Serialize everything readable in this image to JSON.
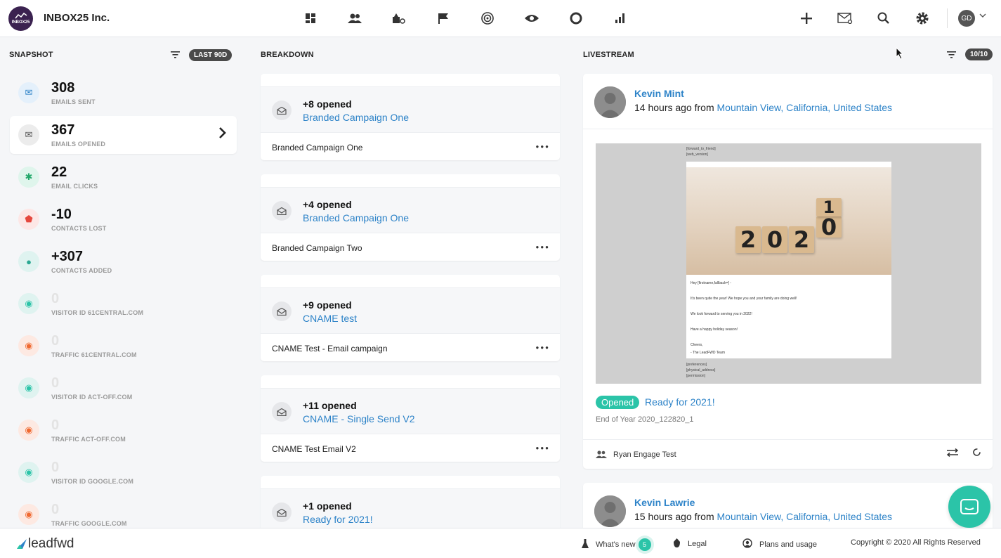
{
  "header": {
    "logo_text": "INBOX25",
    "company": "INBOX25 Inc.",
    "nav_icons": [
      "dashboard-icon",
      "contacts-icon",
      "deals-icon",
      "campaigns-flag-icon",
      "goals-target-icon",
      "visitors-eye-icon",
      "circle-icon",
      "reports-bar-icon"
    ],
    "user_initials": "GD"
  },
  "snapshot": {
    "title": "SNAPSHOT",
    "range": "LAST 90D",
    "items": [
      {
        "value": "308",
        "label": "EMAILS SENT",
        "icon": "✉",
        "bg": "#e4f0fb",
        "fg": "#2d83c8"
      },
      {
        "value": "367",
        "label": "EMAILS OPENED",
        "icon": "✉",
        "bg": "#ececec",
        "fg": "#555"
      },
      {
        "value": "22",
        "label": "EMAIL CLICKS",
        "icon": "✱",
        "bg": "#dff5ec",
        "fg": "#23a86b"
      },
      {
        "value": "-10",
        "label": "CONTACTS LOST",
        "icon": "⬟",
        "bg": "#fde7e6",
        "fg": "#e5483e"
      },
      {
        "value": "+307",
        "label": "CONTACTS ADDED",
        "icon": "●",
        "bg": "#dff3f0",
        "fg": "#2ba893"
      },
      {
        "value": "0",
        "label": "VISITOR ID 61CENTRAL.COM",
        "icon": "◉",
        "bg": "#dff3f0",
        "fg": "#2bc4a8"
      },
      {
        "value": "0",
        "label": "TRAFFIC 61CENTRAL.COM",
        "icon": "◉",
        "bg": "#fde9e2",
        "fg": "#f06a32"
      },
      {
        "value": "0",
        "label": "VISITOR ID ACT-OFF.COM",
        "icon": "◉",
        "bg": "#dff3f0",
        "fg": "#2bc4a8"
      },
      {
        "value": "0",
        "label": "TRAFFIC ACT-OFF.COM",
        "icon": "◉",
        "bg": "#fde9e2",
        "fg": "#f06a32"
      },
      {
        "value": "0",
        "label": "VISITOR ID GOOGLE.COM",
        "icon": "◉",
        "bg": "#dff3f0",
        "fg": "#2bc4a8"
      },
      {
        "value": "0",
        "label": "TRAFFIC GOOGLE.COM",
        "icon": "◉",
        "bg": "#fde9e2",
        "fg": "#f06a32"
      }
    ]
  },
  "breakdown": {
    "title": "BREAKDOWN",
    "cards": [
      {
        "count": "+8 opened",
        "campaign": "Branded Campaign One",
        "name": "Branded Campaign One"
      },
      {
        "count": "+4 opened",
        "campaign": "Branded Campaign One",
        "name": "Branded Campaign Two"
      },
      {
        "count": "+9 opened",
        "campaign": "CNAME test",
        "name": "CNAME Test - Email campaign"
      },
      {
        "count": "+11 opened",
        "campaign": "CNAME - Single Send V2",
        "name": "CNAME Test Email V2"
      },
      {
        "count": "+1 opened",
        "campaign": "Ready for 2021!",
        "name": ""
      }
    ]
  },
  "livestream": {
    "title": "LIVESTREAM",
    "count": "10/10",
    "entries": [
      {
        "name": "Kevin Mint",
        "time": "14 hours ago from ",
        "location": "Mountain View, California, United States",
        "preview": {
          "top_meta": [
            "[forward_to_friend]",
            "[web_version]"
          ],
          "blocks": [
            "2",
            "0",
            "2",
            "0",
            "1"
          ],
          "lines": [
            "Hey [firstname,fallback=] -",
            "It's been quite the year! We hope you and your family are doing well!",
            "We look forward to serving you in 2022!",
            "Have a happy holiday season!",
            "Cheers,",
            "- The LeadFWD Team"
          ],
          "bottom_meta": [
            "[preferences]",
            "[physical_address]",
            "[permission]"
          ]
        },
        "status": "Opened",
        "subject": "Ready for 2021!",
        "campaign": "End of Year 2020_122820_1",
        "owner": "Ryan Engage Test"
      },
      {
        "name": "Kevin Lawrie",
        "time": "15 hours ago from ",
        "location": "Mountain View, California, United States"
      }
    ]
  },
  "footer": {
    "logo": "leadfwd",
    "whats_new": "What's new",
    "whats_new_count": "5",
    "legal": "Legal",
    "plans": "Plans and usage",
    "copyright": "Copyright © 2020 All Rights Reserved"
  },
  "colors": {
    "accent": "#2d83c8",
    "teal": "#2bc4a8",
    "dark_pill": "#4a4a4a"
  }
}
